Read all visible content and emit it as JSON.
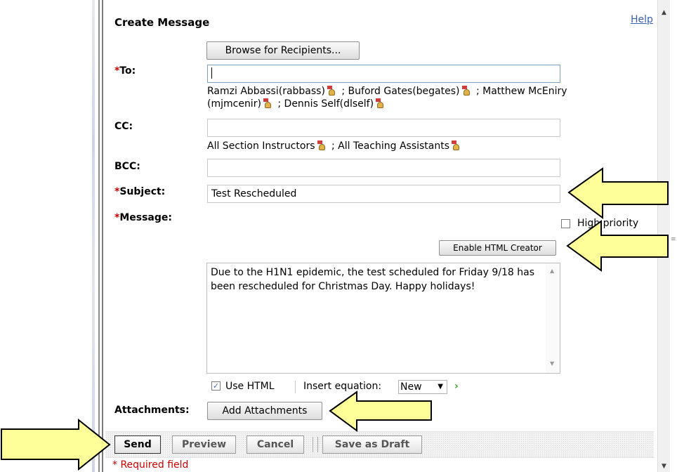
{
  "form": {
    "title": "Create Message",
    "help_link": "Help",
    "browse_button": "Browse for Recipients...",
    "required_mark": "*",
    "to": {
      "label": "To:",
      "value": "",
      "recipients_line1": [
        "Ramzi Abbassi(rabbass)",
        "; Buford Gates(begates)",
        "; Matthew McEniry"
      ],
      "recipients_line2": [
        "(mjmcenir)",
        "; Dennis Self(dlself)"
      ]
    },
    "cc": {
      "label": "CC:",
      "value": "",
      "recipients": [
        "All Section Instructors",
        "; All Teaching Assistants"
      ]
    },
    "bcc": {
      "label": "BCC:",
      "value": ""
    },
    "subject": {
      "label": "Subject:",
      "value": "Test Rescheduled"
    },
    "message": {
      "label": "Message:",
      "high_priority_label": "High priority",
      "high_priority_checked": false,
      "enable_html_button": "Enable HTML Creator",
      "body": "Due to the H1N1 epidemic, the test scheduled for Friday 9/18 has been rescheduled for Christmas Day. Happy holidays!",
      "use_html_label": "Use HTML",
      "use_html_checked": true,
      "insert_equation_label": "Insert equation:",
      "equation_option": "New"
    },
    "attachments": {
      "label": "Attachments:",
      "button": "Add Attachments"
    },
    "actions": {
      "send": "Send",
      "preview": "Preview",
      "cancel": "Cancel",
      "save_draft": "Save as Draft"
    },
    "required_note": "* Required field"
  },
  "icons": {
    "recipient": "recipient-remove-icon",
    "go": "go-arrow-icon",
    "dropdown": "chevron-down-icon"
  },
  "colors": {
    "required": "#cc0000",
    "link": "#3b5fad",
    "callout_fill": "#ffff99"
  }
}
